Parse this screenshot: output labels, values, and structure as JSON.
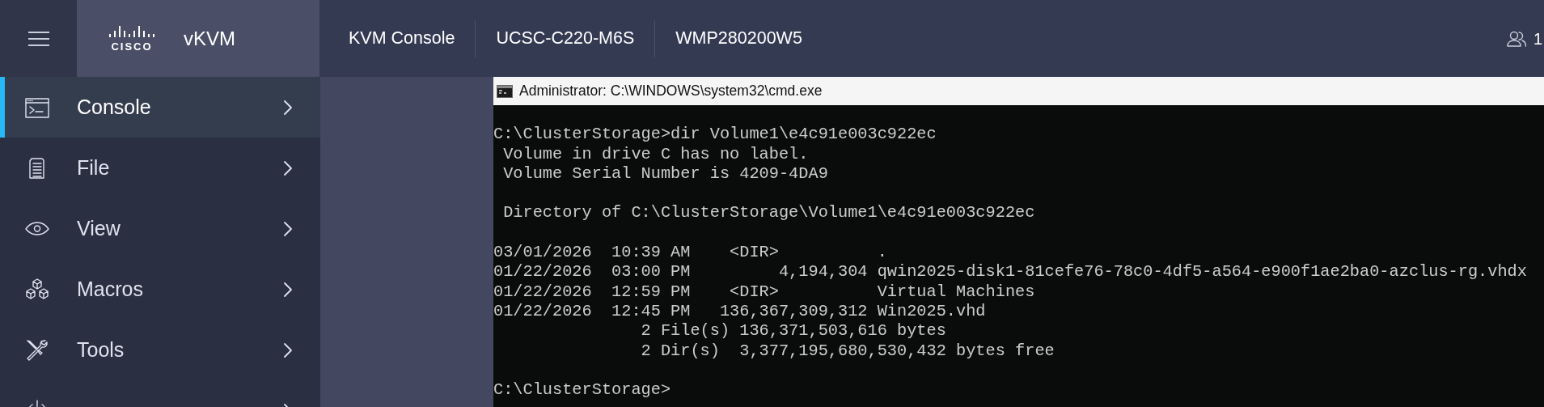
{
  "header": {
    "logo_text": "CISCO",
    "app_title": "vKVM",
    "crumbs": [
      "KVM Console",
      "UCSC-C220-M6S",
      "WMP280200W5"
    ],
    "users_count": "1"
  },
  "sidebar": {
    "items": [
      {
        "label": "Console",
        "kind": "console",
        "selected": true
      },
      {
        "label": "File",
        "kind": "file",
        "selected": false
      },
      {
        "label": "View",
        "kind": "view",
        "selected": false
      },
      {
        "label": "Macros",
        "kind": "macros",
        "selected": false
      },
      {
        "label": "Tools",
        "kind": "tools",
        "selected": false
      },
      {
        "kind": "power",
        "selected": false
      }
    ]
  },
  "console_window": {
    "title": "Administrator: C:\\WINDOWS\\system32\\cmd.exe",
    "blocks": [
      [
        "C:\\ClusterStorage>dir Volume1\\e4c91e003c922ec",
        " Volume in drive C has no label.",
        " Volume Serial Number is 4209-4DA9"
      ],
      [
        " Directory of C:\\ClusterStorage\\Volume1\\e4c91e003c922ec"
      ],
      [
        "03/01/2026  10:39 AM    <DIR>          .",
        "01/22/2026  03:00 PM         4,194,304 qwin2025-disk1-81cefe76-78c0-4df5-a564-e900f1ae2ba0-azclus-rg.vhdx",
        "01/22/2026  12:59 PM    <DIR>          Virtual Machines",
        "01/22/2026  12:45 PM   136,367,309,312 Win2025.vhd",
        "               2 File(s) 136,371,503,616 bytes",
        "               2 Dir(s)  3,377,195,680,530,432 bytes free"
      ],
      [
        "C:\\ClusterStorage>"
      ]
    ]
  }
}
